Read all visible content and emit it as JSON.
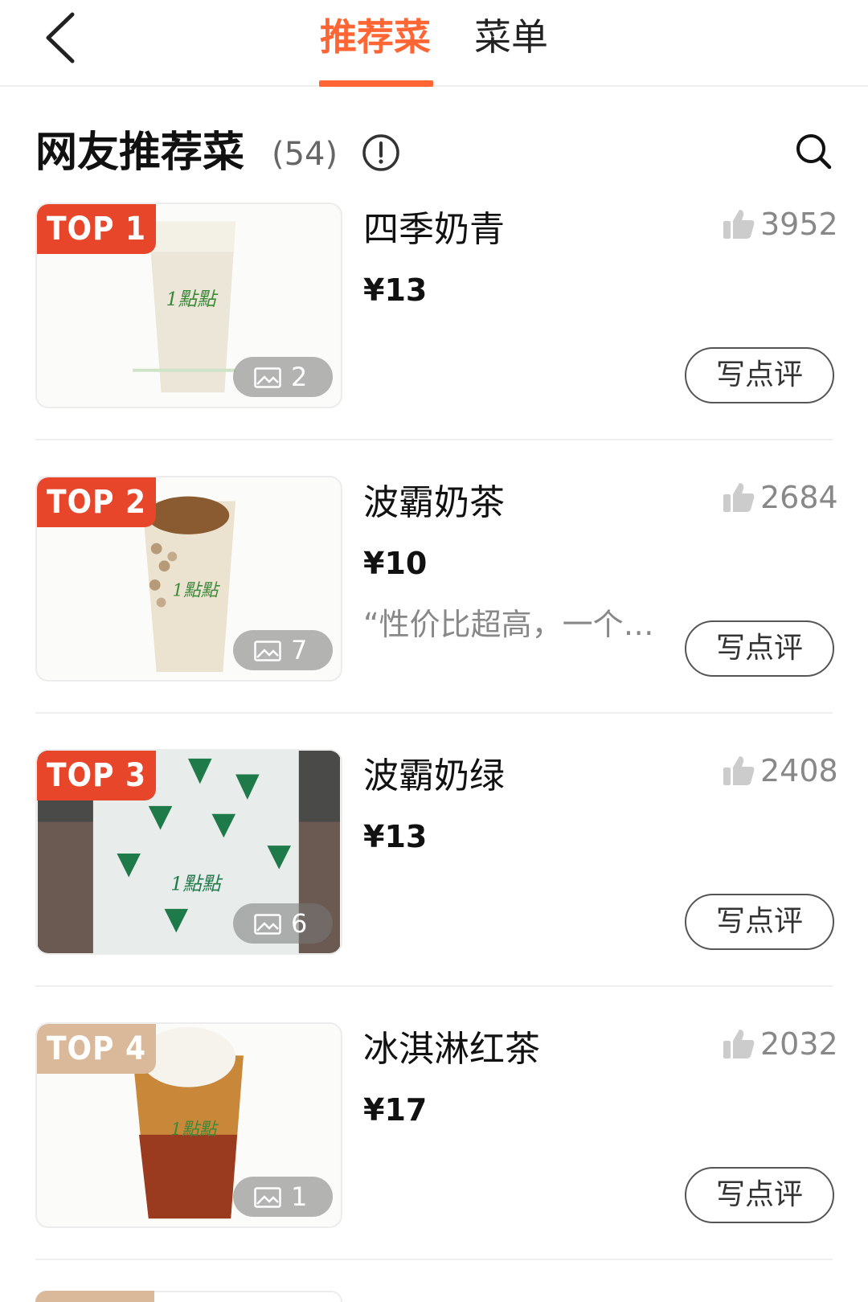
{
  "header": {
    "tabs": [
      {
        "label": "推荐菜",
        "active": true
      },
      {
        "label": "菜单",
        "active": false
      }
    ],
    "accent_color": "#ff6633"
  },
  "section": {
    "title": "网友推荐菜",
    "count": "(54)"
  },
  "dishes": [
    {
      "rank": "TOP 1",
      "name": "四季奶青",
      "price": "¥13",
      "likes": "3952",
      "photos": "2",
      "quote": "",
      "review_label": "写点评",
      "badge_color": "red"
    },
    {
      "rank": "TOP 2",
      "name": "波霸奶茶",
      "price": "¥10",
      "likes": "2684",
      "photos": "7",
      "quote": "“性价比超高，一个…",
      "review_label": "写点评",
      "badge_color": "red"
    },
    {
      "rank": "TOP 3",
      "name": "波霸奶绿",
      "price": "¥13",
      "likes": "2408",
      "photos": "6",
      "quote": "",
      "review_label": "写点评",
      "badge_color": "red"
    },
    {
      "rank": "TOP 4",
      "name": "冰淇淋红茶",
      "price": "¥17",
      "likes": "2032",
      "photos": "1",
      "quote": "",
      "review_label": "写点评",
      "badge_color": "tan"
    }
  ]
}
